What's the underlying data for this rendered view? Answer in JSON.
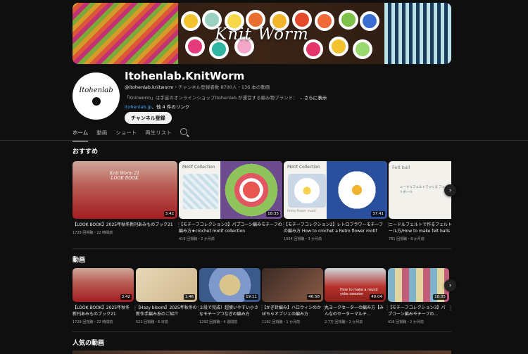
{
  "banner": {
    "brand_text": "Knit Worm"
  },
  "channel": {
    "avatar_text": "Itohenlab",
    "name": "Itohenlab.KnitWorm",
    "handle": "@itohenlab.knitworm",
    "meta": "・チャンネル登録者数 8700人・136 本の動画",
    "description": "「Knitworm」は手芸のオンラインショップItohenlab.が運営する編み物ブランド：",
    "more_label": "...さらに表示",
    "link": "itohenlab.jp",
    "link_more": "、他 4 件のリンク",
    "subscribe_label": "チャンネル登録"
  },
  "tabs": [
    "ホーム",
    "動画",
    "ショート",
    "再生リスト"
  ],
  "sections": {
    "recommended": "おすすめ",
    "videos": "動画",
    "popular": "人気の動画"
  },
  "recommended": [
    {
      "title": "【LOOK BOOK】2025年秋冬新刊あみものブック21",
      "meta": "1729 回視聴・22 時間前",
      "duration": "3:42",
      "overlay": "Knit Worm 21 LOOK BOOK"
    },
    {
      "title": "【モチーフコレクション3】パプコーン編みモチーフの編み方★crochet motif collection",
      "meta": "416 回視聴・2 か月前",
      "duration": "18:35",
      "overlay": "Motif Collection"
    },
    {
      "title": "【モチーフコレクション2】レトロフラワーモチーフの編み方 How to crochet a Retro flower motif",
      "meta": "1054 回視聴・3 か月前",
      "duration": "37:41",
      "overlay": "Motif Collection",
      "sub": "Retro flower motif"
    },
    {
      "title": "ニードルフェルトで作るフェルトボール方/How to make felt balls with nee",
      "meta": "781 回視聴・8 か月前",
      "duration": "",
      "overlay": "Felt ball",
      "sub": "ニードルフェルトでつくる フェルトボール"
    }
  ],
  "videos": [
    {
      "title": "【LOOK BOOK】2025年秋冬新刊あみものブック21",
      "meta": "1729 回視聴・22 時間前",
      "duration": "3:42"
    },
    {
      "title": "【Hazy bloom】2025年秋冬の新作手編み糸のご紹介",
      "meta": "521 回視聴・6 日前",
      "duration": "1:46"
    },
    {
      "title": "２段で完成！超使いやすい小さなモチーフつなぎの編み方",
      "meta": "1292 回視聴・4 週間前",
      "duration": "19:11"
    },
    {
      "title": "【かぎ針編み】ハロウィンのかぼちゃオブジェの編み方",
      "meta": "1192 回視聴・1 か月前",
      "duration": "46:58"
    },
    {
      "title": "丸ヨークセーターの編み方【みんなのセーターマルチ...",
      "meta": "2.7万 回視聴・2 か月前",
      "duration": "49:04",
      "overlay": "How to make a round yoke sweater"
    },
    {
      "title": "【モチーフコレクション3】パプコーン編みモチーフの...",
      "meta": "416 回視聴・2 か月前",
      "duration": "18:35"
    }
  ]
}
